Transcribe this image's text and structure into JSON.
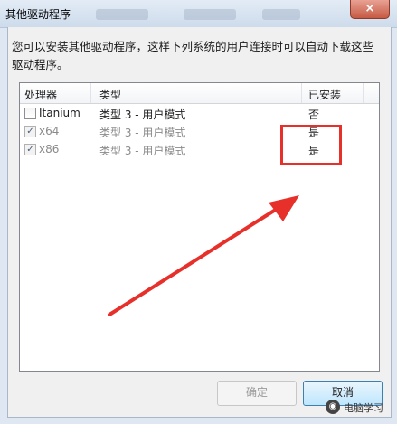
{
  "window": {
    "title": "其他驱动程序",
    "close_glyph": "×"
  },
  "description": "您可以安装其他驱动程序，这样下列系统的用户连接时可以自动下载这些驱动程序。",
  "table": {
    "headers": {
      "processor": "处理器",
      "type": "类型",
      "installed": "已安装"
    },
    "rows": [
      {
        "processor": "Itanium",
        "type": "类型 3 - 用户模式",
        "installed": "否",
        "checked": false,
        "disabled": false
      },
      {
        "processor": "x64",
        "type": "类型 3 - 用户模式",
        "installed": "是",
        "checked": true,
        "disabled": true
      },
      {
        "processor": "x86",
        "type": "类型 3 - 用户模式",
        "installed": "是",
        "checked": true,
        "disabled": true
      }
    ]
  },
  "buttons": {
    "ok": "确定",
    "cancel": "取消"
  },
  "annotation": {
    "color": "#e8302b"
  },
  "watermark": {
    "text": "电脑学习",
    "logo_icon": "wechat-logo-icon"
  }
}
